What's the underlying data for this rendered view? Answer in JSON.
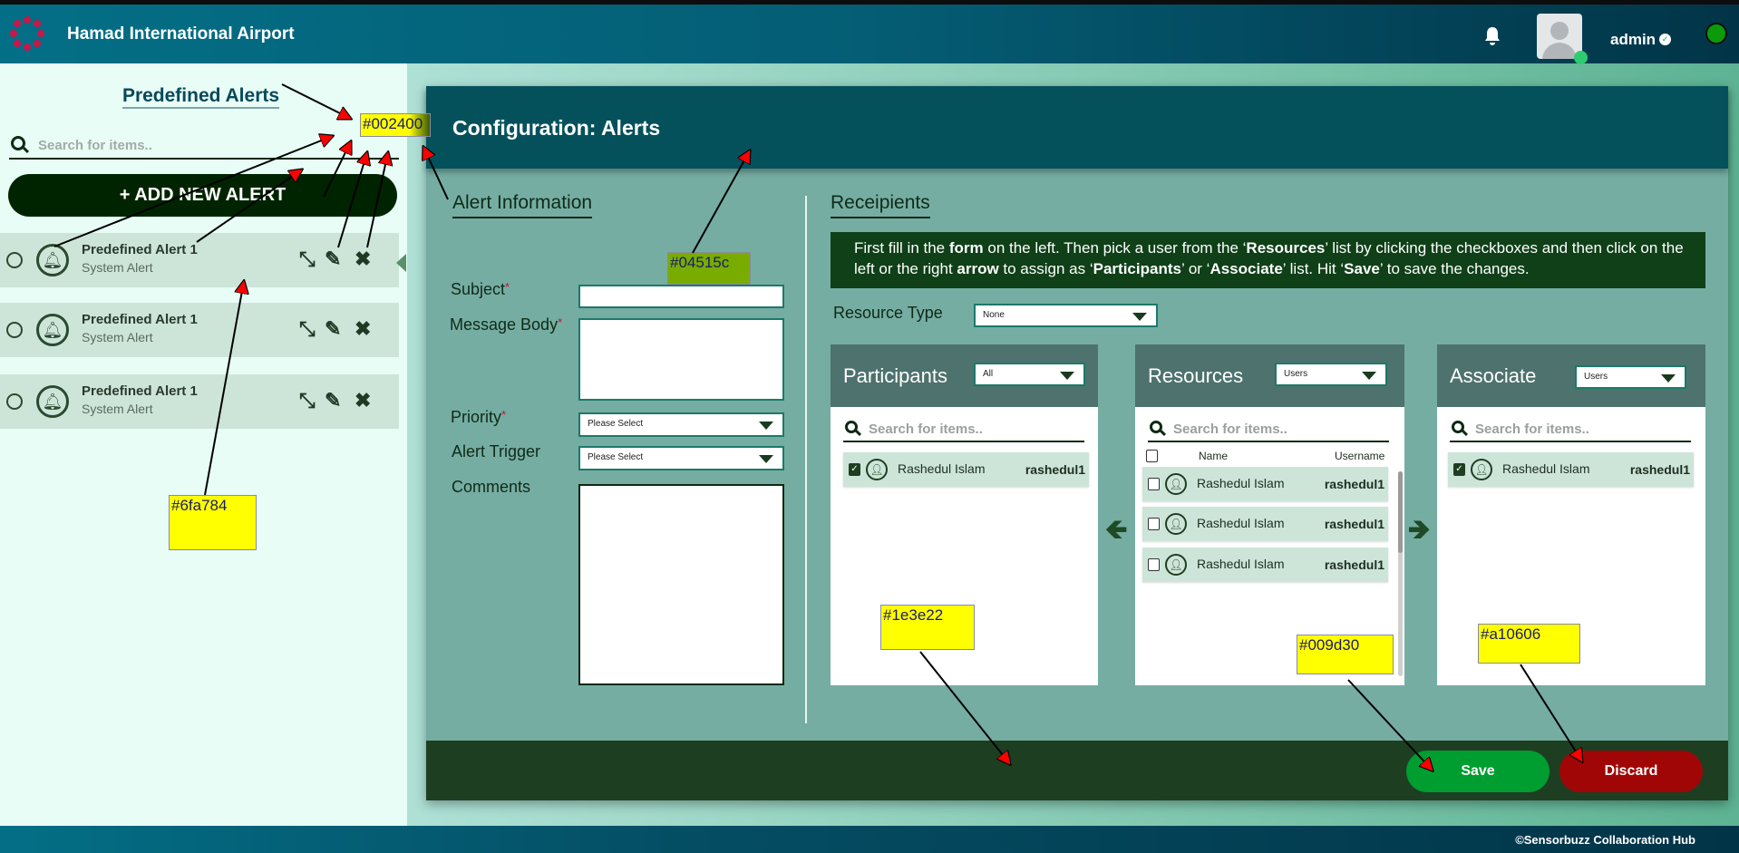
{
  "header": {
    "title": "Hamad International Airport",
    "username": "admin"
  },
  "sidebar": {
    "title": "Predefined Alerts",
    "search_placeholder": "Search for items..",
    "add_button": "+ ADD NEW ALERT",
    "items": [
      {
        "title": "Predefined Alert 1",
        "subtitle": "System Alert"
      },
      {
        "title": "Predefined Alert 1",
        "subtitle": "System Alert"
      },
      {
        "title": "Predefined Alert 1",
        "subtitle": "System Alert"
      }
    ]
  },
  "config": {
    "title": "Configuration: Alerts",
    "alert_info": {
      "heading": "Alert Information",
      "subject_label": "Subject",
      "message_label": "Message Body",
      "priority_label": "Priority",
      "priority_value": "Please Select",
      "trigger_label": "Alert Trigger",
      "trigger_value": "Please Select",
      "comments_label": "Comments",
      "required_mark": "*"
    },
    "recipients": {
      "heading": "Receipients",
      "info_parts": [
        "First fill in the ",
        "form",
        " on the left. Then pick a user from the ‘",
        "Resources",
        "’ list by clicking the checkboxes and then click on the left or the right ",
        "arrow",
        " to assign as ‘",
        "Participants",
        "’ or ‘",
        "Associate",
        "’ list. Hit ‘",
        "Save",
        "’ to save the changes."
      ],
      "resource_type_label": "Resource Type",
      "resource_type_value": "None",
      "search_placeholder": "Search for items..",
      "participants": {
        "title": "Participants",
        "filter": "All",
        "rows": [
          {
            "name": "Rashedul Islam",
            "username": "rashedul1",
            "checked": true
          }
        ]
      },
      "resources": {
        "title": "Resources",
        "filter": "Users",
        "col_name": "Name",
        "col_username": "Username",
        "rows": [
          {
            "name": "Rashedul Islam",
            "username": "rashedul1",
            "checked": false
          },
          {
            "name": "Rashedul Islam",
            "username": "rashedul1",
            "checked": false
          },
          {
            "name": "Rashedul Islam",
            "username": "rashedul1",
            "checked": false
          }
        ]
      },
      "associate": {
        "title": "Associate",
        "filter": "Users",
        "rows": [
          {
            "name": "Rashedul Islam",
            "username": "rashedul1",
            "checked": true
          }
        ]
      }
    },
    "save": "Save",
    "discard": "Discard"
  },
  "footer": {
    "copyright": "©Sensorbuzz Collaboration Hub"
  },
  "annotations": {
    "c1": "#002400",
    "c2": "#04515c",
    "c3": "#6fa784",
    "c4": "#1e3e22",
    "c5": "#009d30",
    "c6": "#a10606"
  },
  "colors": {
    "dark_green": "#002400",
    "card_header": "#04515c",
    "list_item": "#6fa784",
    "footer_bar": "#1e3e22",
    "save": "#009d30",
    "discard": "#a10606"
  }
}
